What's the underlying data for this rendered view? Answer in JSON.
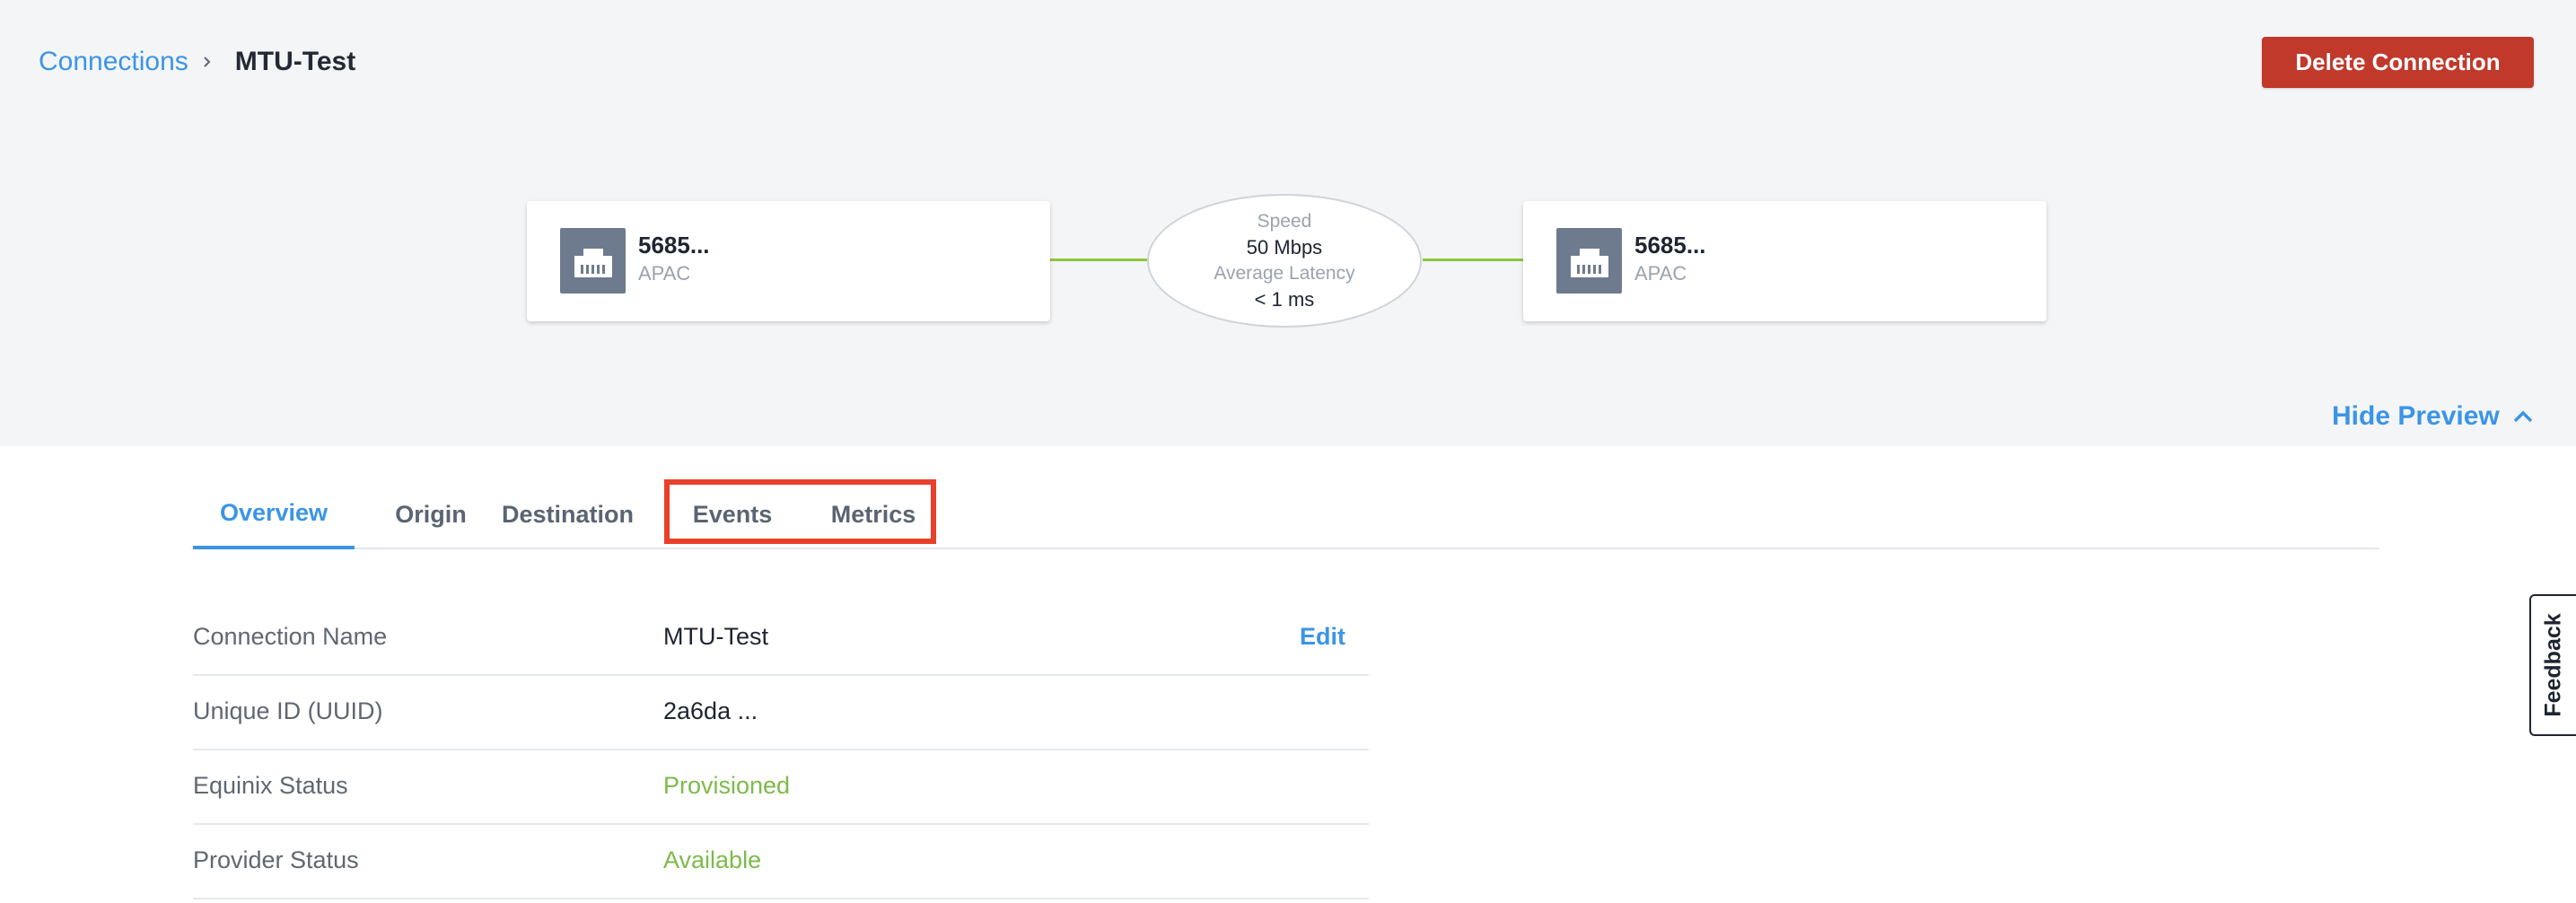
{
  "breadcrumb": {
    "parent": "Connections",
    "current": "MTU-Test"
  },
  "actions": {
    "delete_label": "Delete Connection"
  },
  "preview": {
    "origin": {
      "name": "5685...",
      "region": "APAC",
      "icon": "ethernet-port-icon"
    },
    "destination": {
      "name": "5685...",
      "region": "APAC",
      "icon": "ethernet-port-icon"
    },
    "speed_label": "Speed",
    "speed_value": "50 Mbps",
    "latency_label": "Average Latency",
    "latency_value": "< 1 ms",
    "line_color": "#8cc63f",
    "hide_label": "Hide Preview"
  },
  "tabs": [
    {
      "label": "Overview",
      "active": true
    },
    {
      "label": "Origin",
      "active": false
    },
    {
      "label": "Destination",
      "active": false
    },
    {
      "label": "Events",
      "active": false
    },
    {
      "label": "Metrics",
      "active": false
    }
  ],
  "details": [
    {
      "label": "Connection Name",
      "value": "MTU-Test",
      "action": "Edit"
    },
    {
      "label": "Unique ID (UUID)",
      "value": "2a6da ..."
    },
    {
      "label": "Equinix Status",
      "value": "Provisioned",
      "color": "#7cbb4a"
    },
    {
      "label": "Provider Status",
      "value": "Available",
      "color": "#7cbb4a"
    }
  ],
  "feedback_label": "Feedback",
  "colors": {
    "accent": "#3b95e6",
    "danger": "#c0392b",
    "success": "#7cbb4a",
    "highlight": "#e8402a"
  }
}
